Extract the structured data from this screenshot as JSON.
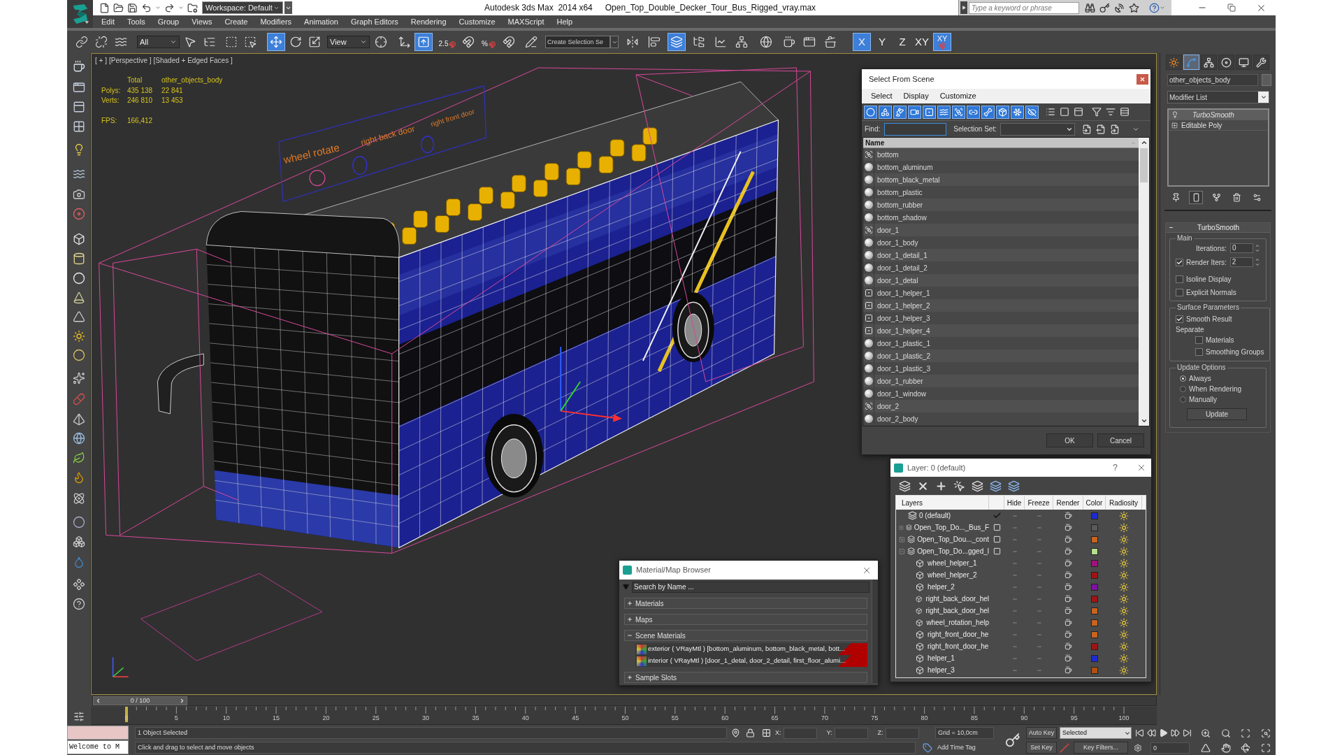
{
  "title_bar": {
    "workspace": "Workspace: Default",
    "app_title": "Autodesk 3ds Max  2014 x64",
    "file_name": "Open_Top_Double_Decker_Tour_Bus_Rigged_vray.max",
    "search": {
      "placeholder": "Type a keyword or phrase"
    }
  },
  "menu": [
    "Edit",
    "Tools",
    "Group",
    "Views",
    "Create",
    "Modifiers",
    "Animation",
    "Graph Editors",
    "Rendering",
    "Customize",
    "MAXScript",
    "Help"
  ],
  "main_toolbar": {
    "items": [
      {
        "kind": "button",
        "on": false
      },
      {
        "kind": "button",
        "on": false
      },
      {
        "kind": "button",
        "on": false
      },
      {
        "kind": "dropdown",
        "value": "All"
      },
      {
        "kind": "button",
        "on": false
      },
      {
        "kind": "button",
        "on": false
      },
      {
        "kind": "button",
        "on": false
      },
      {
        "kind": "button",
        "on": false
      },
      {
        "kind": "button",
        "on": true
      },
      {
        "kind": "button",
        "on": false
      },
      {
        "kind": "button",
        "on": false
      },
      {
        "kind": "dropdown",
        "value": "View"
      },
      {
        "kind": "button",
        "on": false
      },
      {
        "kind": "button",
        "on": false
      },
      {
        "kind": "button",
        "on": true
      },
      {
        "kind": "snap",
        "label": "2.5",
        "on": false
      },
      {
        "kind": "button",
        "on": false
      },
      {
        "kind": "snap",
        "label": "%",
        "on": false
      },
      {
        "kind": "button",
        "on": false
      },
      {
        "kind": "button",
        "on": false
      },
      {
        "kind": "combo",
        "placeholder": "Create Selection Se"
      },
      {
        "kind": "button",
        "on": false
      },
      {
        "kind": "button",
        "on": false
      },
      {
        "kind": "button",
        "on": true
      },
      {
        "kind": "button",
        "on": false
      },
      {
        "kind": "button",
        "on": false
      },
      {
        "kind": "button",
        "on": false
      },
      {
        "kind": "button",
        "on": false
      },
      {
        "kind": "button",
        "on": false
      },
      {
        "kind": "button",
        "on": false
      },
      {
        "kind": "button",
        "on": false
      },
      {
        "kind": "axis",
        "label": "X",
        "on": true
      },
      {
        "kind": "axis",
        "label": "Y",
        "on": false
      },
      {
        "kind": "axis",
        "label": "Z",
        "on": false
      },
      {
        "kind": "axis",
        "label": "XY",
        "on": false
      },
      {
        "kind": "axis_snap",
        "label": "XY",
        "on": true
      }
    ]
  },
  "viewport": {
    "labels": [
      "[ + ]",
      "[Perspective ]",
      "[Shaded + Edged Faces ]"
    ],
    "stats": {
      "columns": [
        "Total",
        "other_objects_body"
      ],
      "rows": [
        {
          "label": "Polys:",
          "values": [
            "435 138",
            "22 841"
          ]
        },
        {
          "label": "Verts:",
          "values": [
            "246 810",
            "13 453"
          ]
        }
      ],
      "fps": {
        "label": "FPS:",
        "value": "166,412"
      }
    },
    "scene_texts": [
      "wheel rotate",
      "right back door",
      "right front door"
    ]
  },
  "select_dialog": {
    "title": "Select From Scene",
    "menu": [
      "Select",
      "Display",
      "Customize"
    ],
    "filters": [
      {
        "on": true
      },
      {
        "on": true
      },
      {
        "on": true
      },
      {
        "on": true
      },
      {
        "on": true
      },
      {
        "on": true
      },
      {
        "on": true
      },
      {
        "on": true
      },
      {
        "on": true
      },
      {
        "on": true
      },
      {
        "on": true
      },
      {
        "on": true
      }
    ],
    "find": {
      "label": "Find:"
    },
    "selection_set": {
      "label": "Selection Set:"
    },
    "column": "Name",
    "rows": [
      {
        "name": "bottom",
        "kind": "group",
        "selected": false
      },
      {
        "name": "bottom_aluminum",
        "kind": "geometry",
        "selected": false
      },
      {
        "name": "bottom_black_metal",
        "kind": "geometry",
        "selected": false
      },
      {
        "name": "bottom_plastic",
        "kind": "geometry",
        "selected": false
      },
      {
        "name": "bottom_rubber",
        "kind": "geometry",
        "selected": false
      },
      {
        "name": "bottom_shadow",
        "kind": "geometry",
        "selected": false
      },
      {
        "name": "door_1",
        "kind": "group",
        "selected": false
      },
      {
        "name": "door_1_body",
        "kind": "geometry",
        "selected": false
      },
      {
        "name": "door_1_detail_1",
        "kind": "geometry",
        "selected": false
      },
      {
        "name": "door_1_detail_2",
        "kind": "geometry",
        "selected": false
      },
      {
        "name": "door_1_detal",
        "kind": "geometry",
        "selected": false
      },
      {
        "name": "door_1_helper_1",
        "kind": "helper",
        "selected": false
      },
      {
        "name": "door_1_helper_2",
        "kind": "helper",
        "selected": false
      },
      {
        "name": "door_1_helper_3",
        "kind": "helper",
        "selected": false
      },
      {
        "name": "door_1_helper_4",
        "kind": "helper",
        "selected": false
      },
      {
        "name": "door_1_plastic_1",
        "kind": "geometry",
        "selected": false
      },
      {
        "name": "door_1_plastic_2",
        "kind": "geometry",
        "selected": false
      },
      {
        "name": "door_1_plastic_3",
        "kind": "geometry",
        "selected": false
      },
      {
        "name": "door_1_rubber",
        "kind": "geometry",
        "selected": false
      },
      {
        "name": "door_1_window",
        "kind": "geometry",
        "selected": false
      },
      {
        "name": "door_2",
        "kind": "group",
        "selected": false
      },
      {
        "name": "door_2_body",
        "kind": "geometry",
        "selected": false
      }
    ],
    "buttons": [
      "OK",
      "Cancel"
    ]
  },
  "layer_dialog": {
    "title": "Layer: 0 (default)",
    "help": "?",
    "columns": [
      "Layers",
      "Hide",
      "Freeze",
      "Render",
      "Color",
      "Radiosity"
    ],
    "layers": [
      {
        "name": "0 (default)",
        "current": true,
        "color": "#1e2bd0"
      },
      {
        "name": "Open_Top_Do..._Bus_F",
        "current": false,
        "expanded": false,
        "color": "#5a5a5a"
      },
      {
        "name": "Open_Top_Dou..._cont",
        "current": false,
        "expanded": false,
        "color": "#c8641e"
      },
      {
        "name": "Open_Top_Do...gged_l",
        "current": false,
        "expanded": true,
        "color": "#b4e08c",
        "children": [
          {
            "name": "wheel_helper_1",
            "color": "#a0127e"
          },
          {
            "name": "wheel_helper_2",
            "color": "#a01414"
          },
          {
            "name": "helper_2",
            "color": "#7d12a0"
          },
          {
            "name": "right_back_door_hel",
            "color": "#a01414"
          },
          {
            "name": "right_back_door_hel",
            "color": "#c8641e"
          },
          {
            "name": "wheel_rotation_help",
            "color": "#c8641e"
          },
          {
            "name": "right_front_door_he",
            "color": "#c8641e"
          },
          {
            "name": "right_front_door_he",
            "color": "#a01414"
          },
          {
            "name": "helper_1",
            "color": "#1e2bd0"
          },
          {
            "name": "helper_3",
            "color": "#b4500f"
          }
        ]
      }
    ]
  },
  "material_browser": {
    "title": "Material/Map Browser",
    "search": {
      "placeholder": "Search by Name ..."
    },
    "sections": [
      {
        "title": "Materials",
        "expanded": false
      },
      {
        "title": "Maps",
        "expanded": false
      },
      {
        "title": "Scene Materials",
        "expanded": true,
        "items": [
          "exterior ( VRayMtl ) [bottom_aluminum, bottom_black_metal, bott...",
          "interior ( VRayMtl ) [door_1_detal, door_2_detail, first_floor_alumi..."
        ]
      },
      {
        "title": "Sample Slots",
        "expanded": false
      }
    ]
  },
  "command_panel": {
    "tabs": [
      {
        "selected": false
      },
      {
        "selected": true
      },
      {
        "selected": false
      },
      {
        "selected": false
      },
      {
        "selected": false
      },
      {
        "selected": false
      }
    ],
    "object_name": "other_objects_body",
    "modifier_list": "Modifier List",
    "stack": [
      {
        "name": "TurboSmooth",
        "kind": "modifier",
        "selected": true
      },
      {
        "name": "Editable Poly",
        "kind": "base",
        "selected": false,
        "expanded": false
      }
    ],
    "stack_tools": [
      {
        "on": false
      },
      {
        "on": true
      },
      {
        "on": false
      },
      {
        "on": false
      },
      {
        "on": false
      }
    ],
    "rollout": {
      "title": "TurboSmooth",
      "expanded": true,
      "main": {
        "title": "Main",
        "iterations": {
          "label": "Iterations:",
          "value": "0"
        },
        "render_iters": {
          "label": "Render Iters:",
          "value": "2",
          "checked": true
        },
        "options": [
          {
            "label": "Isoline Display",
            "checked": false
          },
          {
            "label": "Explicit Normals",
            "checked": false
          }
        ]
      },
      "surface": {
        "title": "Surface Parameters",
        "smooth_result": {
          "label": "Smooth Result",
          "checked": true
        },
        "separate": {
          "label": "Separate",
          "options": [
            {
              "label": "Materials",
              "checked": false
            },
            {
              "label": "Smoothing Groups",
              "checked": false
            }
          ]
        }
      },
      "update": {
        "title": "Update Options",
        "modes": [
          {
            "label": "Always",
            "selected": true
          },
          {
            "label": "When Rendering",
            "selected": false
          },
          {
            "label": "Manually",
            "selected": false
          }
        ],
        "button": "Update"
      }
    }
  },
  "time_slider": {
    "label": "0 / 100",
    "level": 0
  },
  "track_bar": {
    "ticks": [
      "0",
      "5",
      "10",
      "15",
      "20",
      "25",
      "30",
      "35",
      "40",
      "45",
      "50",
      "55",
      "60",
      "65",
      "70",
      "75",
      "80",
      "85",
      "90",
      "95",
      "100"
    ]
  },
  "status_bar": {
    "listener_output": "Welcome to M",
    "selection": "1 Object Selected",
    "prompt": "Click and drag to select and move objects",
    "coords": [
      {
        "label": "X:"
      },
      {
        "label": "Y:"
      },
      {
        "label": "Z:"
      }
    ],
    "grid": "Grid = 10,0cm",
    "add_time_tag": "Add Time Tag",
    "auto_key": {
      "label": "Auto Key",
      "on": false
    },
    "set_key": "Set Key",
    "key_mode": "Selected",
    "key_filters": "Key Filters...",
    "frame": "0"
  }
}
